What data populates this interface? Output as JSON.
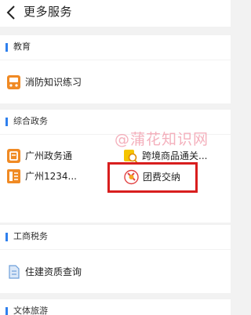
{
  "header": {
    "title": "更多服务"
  },
  "sections": [
    {
      "title": "教育",
      "items": [
        {
          "label": "消防知识练习",
          "icon": "quiz-icon"
        }
      ]
    },
    {
      "title": "综合政务",
      "items": [
        {
          "label": "广州政务通",
          "icon": "government-app-icon"
        },
        {
          "label": "跨境商品通关...",
          "icon": "customs-search-icon"
        },
        {
          "label": "广州1234...",
          "icon": "hotline-icon"
        },
        {
          "label": "团费交纳",
          "icon": "youth-league-fee-icon"
        }
      ]
    },
    {
      "title": "工商税务",
      "items": [
        {
          "label": "住建资质查询",
          "icon": "document-icon"
        }
      ]
    },
    {
      "title": "文体旅游",
      "items": []
    }
  ],
  "watermark": "@蒲花知识网",
  "colors": {
    "accent": "#2f80ed",
    "icon_orange": "#f08a24",
    "highlight": "#d81e1e"
  }
}
